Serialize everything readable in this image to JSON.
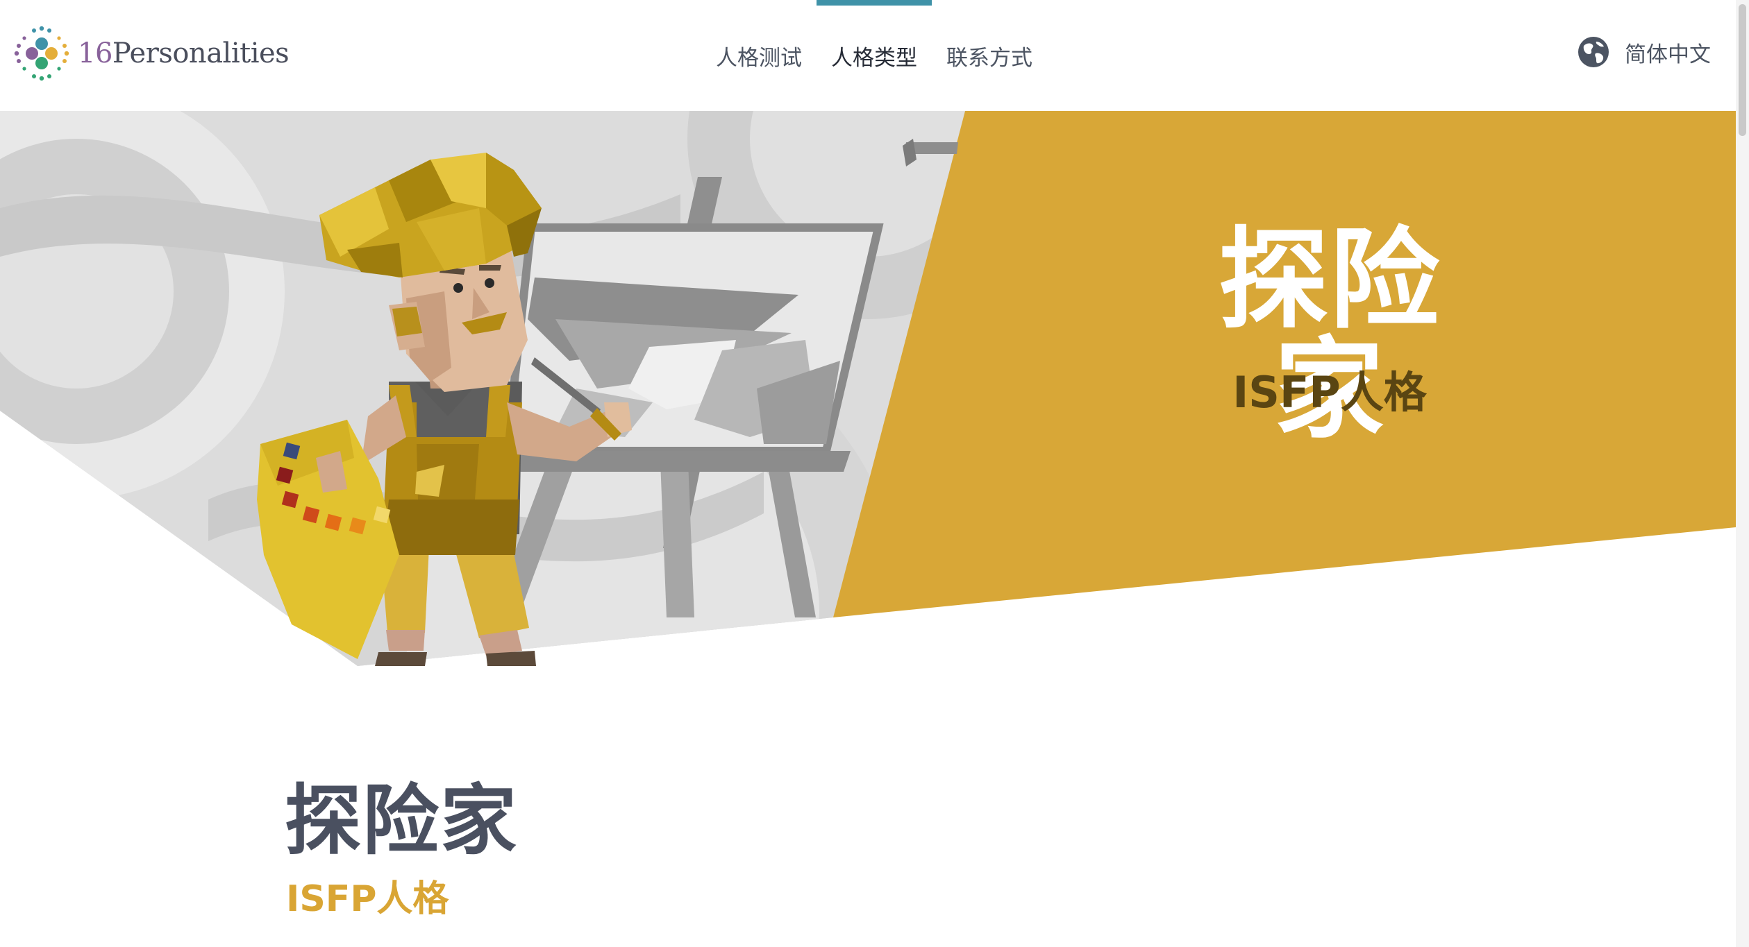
{
  "header": {
    "logo": {
      "number": "16",
      "word": "Personalities"
    },
    "nav": [
      {
        "label": "人格测试"
      },
      {
        "label": "人格类型"
      },
      {
        "label": "联系方式"
      }
    ],
    "active_nav_index": 1,
    "language": {
      "label": "简体中文",
      "icon": "globe-icon"
    }
  },
  "hero": {
    "title": "探险家",
    "subtitle": "ISFP人格",
    "illustration": "artist-painting-at-easel"
  },
  "content": {
    "title": "探险家",
    "subtitle": "ISFP人格"
  },
  "colors": {
    "accent": "#d9a534",
    "nav_active_bar": "#3f92a8",
    "hero_subtitle": "#5a4512",
    "heading": "#4a5060"
  }
}
